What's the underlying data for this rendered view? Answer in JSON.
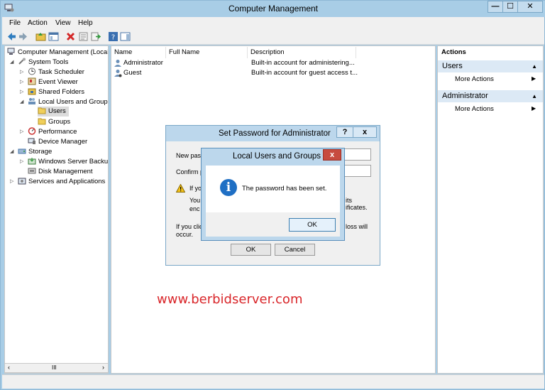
{
  "window": {
    "title": "Computer Management",
    "min": "—",
    "max": "☐",
    "close": "✕"
  },
  "menu": [
    "File",
    "Action",
    "View",
    "Help"
  ],
  "tree": {
    "root": "Computer Management (Local",
    "system_tools": "System Tools",
    "task_scheduler": "Task Scheduler",
    "event_viewer": "Event Viewer",
    "shared_folders": "Shared Folders",
    "local_users": "Local Users and Groups",
    "users": "Users",
    "groups": "Groups",
    "performance": "Performance",
    "device_manager": "Device Manager",
    "storage": "Storage",
    "backup": "Windows Server Backup",
    "disk": "Disk Management",
    "services": "Services and Applications",
    "scroll_thumb": "III"
  },
  "list": {
    "columns": [
      "Name",
      "Full Name",
      "Description"
    ],
    "rows": [
      {
        "name": "Administrator",
        "full": "",
        "desc": "Built-in account for administering..."
      },
      {
        "name": "Guest",
        "full": "",
        "desc": "Built-in account for guest access t..."
      }
    ]
  },
  "actions": {
    "header": "Actions",
    "section1": "Users",
    "section1_item": "More Actions",
    "section2": "Administrator",
    "section2_item": "More Actions"
  },
  "pw_dialog": {
    "title": "Set Password for Administrator",
    "help": "?",
    "close": "x",
    "new_label": "New pass",
    "confirm_label": "Confirm pa",
    "warn_a": "If yo",
    "warn_b": "You",
    "warn_c": "enc",
    "right_a": "its",
    "right_b": "ificates.",
    "click_a": "If you click",
    "click_b": "occur.",
    "click_right": "loss will",
    "ok": "OK",
    "cancel": "Cancel"
  },
  "msg_dialog": {
    "title": "Local Users and Groups",
    "close": "x",
    "text": "The password has been set.",
    "ok": "OK"
  },
  "watermark": "www.berbidserver.com"
}
